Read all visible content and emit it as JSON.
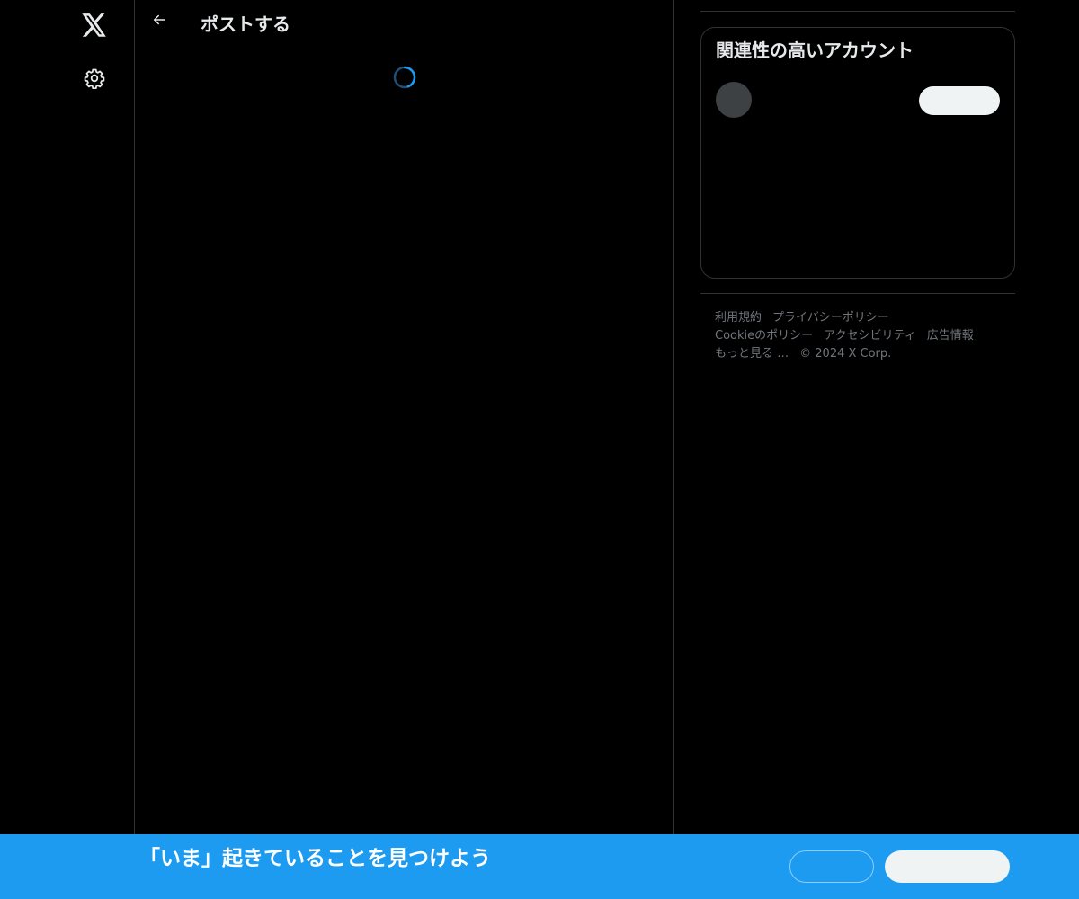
{
  "nav": {
    "logo_icon": "x-logo-icon",
    "settings_icon": "gear-icon"
  },
  "header": {
    "back_icon": "arrow-left-icon",
    "title": "ポストする"
  },
  "main": {
    "loading_icon": "spinner-icon"
  },
  "sidebar": {
    "related_title": "関連性の高いアカウント",
    "footer_links": [
      "利用規約",
      "プライバシーポリシー",
      "Cookieのポリシー",
      "アクセシビリティ",
      "広告情報",
      "もっと見る …",
      "© 2024 X Corp."
    ]
  },
  "banner": {
    "text": "「いま」起きていることを見つけよう"
  },
  "colors": {
    "background": "#000000",
    "border": "#2f3336",
    "accent": "#1d9bf0",
    "text": "#e7e9ea",
    "muted": "#71767b"
  }
}
